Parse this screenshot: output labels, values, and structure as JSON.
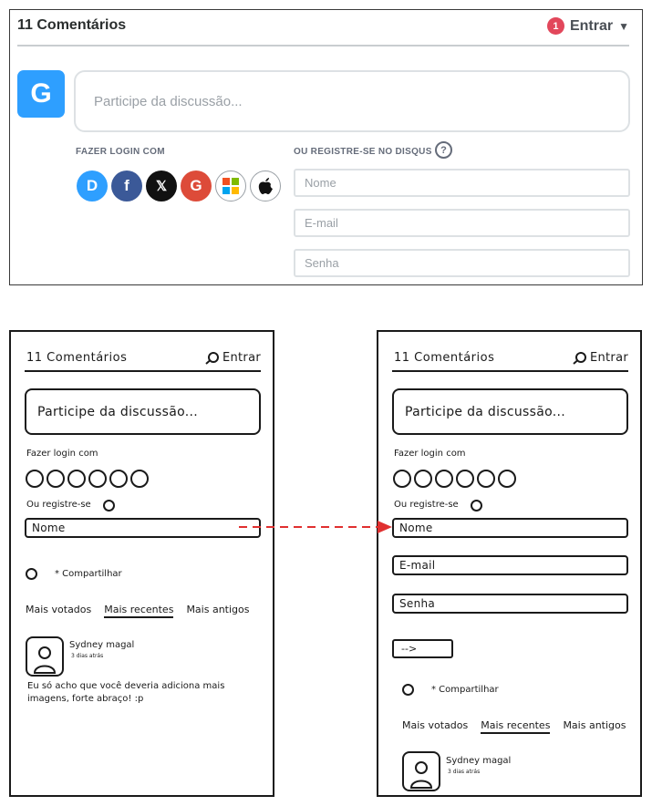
{
  "widget": {
    "comment_count": "11 Comentários",
    "notification_count": "1",
    "login_label": "Entrar",
    "avatar_letter": "G",
    "textarea_placeholder": "Participe da discussão...",
    "login_with_label": "FAZER LOGIN COM",
    "register_label": "OU REGISTRE-SE NO DISQUS",
    "help_symbol": "?",
    "social": [
      {
        "icon": "disqus-icon",
        "glyph": "D",
        "color": "#2e9fff"
      },
      {
        "icon": "facebook-icon",
        "glyph": "f",
        "color": "#3b5998"
      },
      {
        "icon": "x-icon",
        "glyph": "𝕏",
        "color": "#111111"
      },
      {
        "icon": "google-icon",
        "glyph": "G",
        "color": "#dd4b39"
      },
      {
        "icon": "microsoft-icon",
        "glyph": "",
        "color": "#ffffff"
      },
      {
        "icon": "apple-icon",
        "glyph": "",
        "color": "#ffffff"
      }
    ],
    "name_placeholder": "Nome",
    "email_placeholder": "E-mail",
    "password_placeholder": "Senha"
  },
  "sketch_left": {
    "comment_count": "11 Comentários",
    "login_label": "Entrar",
    "textarea_placeholder": "Participe da discussão...",
    "login_with_label": "Fazer login com",
    "register_label": "Ou registre-se",
    "name_field": "Nome",
    "share_label": "* Compartilhar",
    "tabs": [
      "Mais votados",
      "Mais recentes",
      "Mais antigos"
    ],
    "author": "Sydney magal",
    "time": "3 dias atrás",
    "comment": "Eu só acho que você deveria adiciona mais imagens, forte abraço! :p"
  },
  "sketch_right": {
    "comment_count": "11 Comentários",
    "login_label": "Entrar",
    "textarea_placeholder": "Participe da discussão...",
    "login_with_label": "Fazer login com",
    "register_label": "Ou registre-se",
    "name_field": "Nome",
    "email_field": "E-mail",
    "password_field": "Senha",
    "submit_label": "-->",
    "share_label": "* Compartilhar",
    "tabs": [
      "Mais votados",
      "Mais recentes",
      "Mais antigos"
    ],
    "author": "Sydney magal",
    "time": "3 dias atrás"
  },
  "colors": {
    "accent": "#2e9fff",
    "badge": "#e2475b",
    "arrow": "#e03030"
  }
}
